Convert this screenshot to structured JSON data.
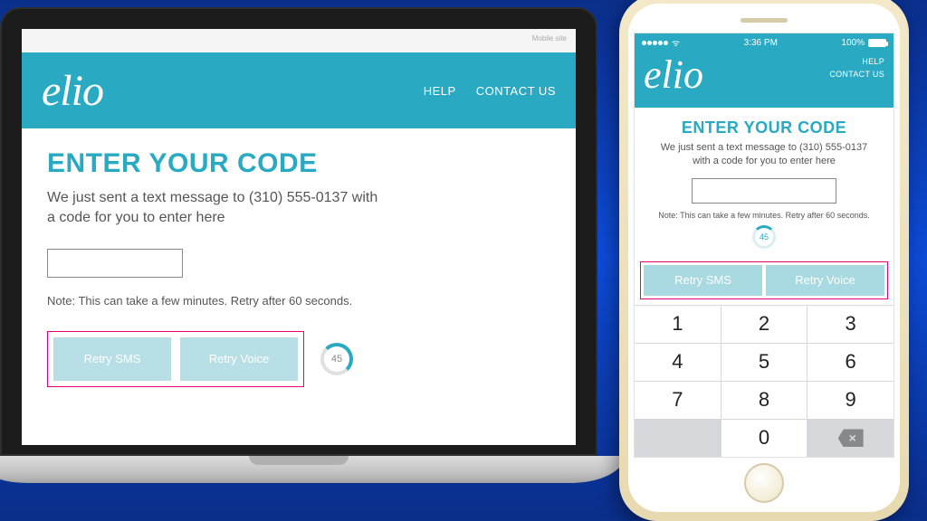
{
  "brand": {
    "name": "elio"
  },
  "desktop": {
    "topstrip": "Mobile site",
    "nav": {
      "help": "HELP",
      "contact": "CONTACT US"
    },
    "title": "ENTER YOUR CODE",
    "subtitle": "We just sent a text message to (310) 555-0137 with a code for you to enter here",
    "code_value": "",
    "note": "Note: This can take a few minutes. Retry after 60 seconds.",
    "retry_sms": "Retry SMS",
    "retry_voice": "Retry Voice",
    "countdown": "45"
  },
  "mobile": {
    "status": {
      "time": "3:36 PM",
      "battery_pct": "100%"
    },
    "nav": {
      "help": "HELP",
      "contact": "CONTACT US"
    },
    "title": "ENTER YOUR CODE",
    "subtitle": "We just sent a text message to (310) 555-0137 with a code for you to enter here",
    "code_value": "",
    "note": "Note: This can take a few minutes. Retry after 60 seconds.",
    "countdown": "45",
    "retry_sms": "Retry SMS",
    "retry_voice": "Retry Voice",
    "keypad": [
      "1",
      "2",
      "3",
      "4",
      "5",
      "6",
      "7",
      "8",
      "9",
      "",
      "0",
      "⌫"
    ]
  }
}
